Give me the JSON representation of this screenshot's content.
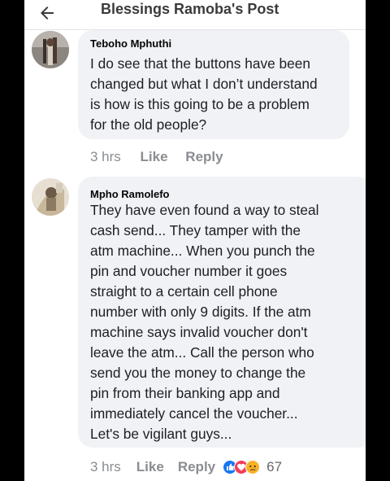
{
  "header": {
    "title": "Blessings Ramoba's Post"
  },
  "comments": [
    {
      "author": "Teboho Mphuthi",
      "text": "I do see that the buttons have been\nchanged but what I don’t understand\nis how is this going to be a problem\nfor the old people?",
      "time": "3 hrs",
      "like": "Like",
      "reply": "Reply"
    },
    {
      "author": "Mpho Ramolefo",
      "text": "They have even found a way to steal\ncash send... They tamper with the\natm machine... When you punch the\npin and voucher number it goes\nstraight to a certain cell phone\nnumber with only 9 digits. If the atm\nmachine says invalid voucher don't\nleave the atm... Call the person who\nsend you the money to change the\npin from their banking app and\nimmediately cancel the voucher...\nLet's be vigilant guys...",
      "time": "3 hrs",
      "like": "Like",
      "reply": "Reply",
      "reaction_count": "67"
    }
  ],
  "colors": {
    "like_blue": "#1877f2",
    "love_red": "#f33e58",
    "sad_yellow": "#f7b125"
  }
}
